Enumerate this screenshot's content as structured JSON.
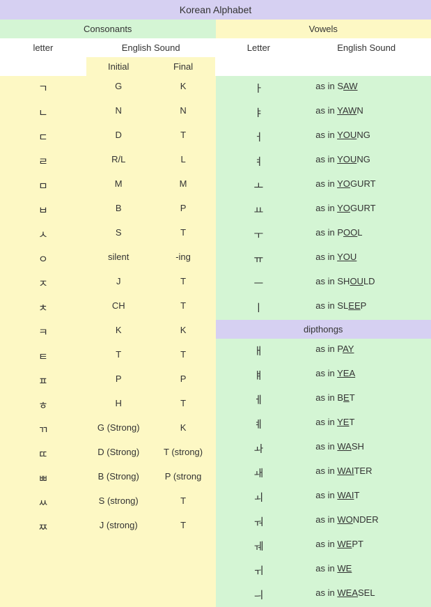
{
  "title": "Korean Alphabet",
  "headers": {
    "consonants": "Consonants",
    "vowels": "Vowels",
    "letter_left": "letter",
    "sound_left": "English Sound",
    "letter_right": "Letter",
    "sound_right": "English Sound",
    "initial": "Initial",
    "final": "Final",
    "dipthongs": "dipthongs"
  },
  "prefix": "as in ",
  "consonants": [
    {
      "letter": "ㄱ",
      "initial": "G",
      "final": "K"
    },
    {
      "letter": "ㄴ",
      "initial": "N",
      "final": "N"
    },
    {
      "letter": "ㄷ",
      "initial": "D",
      "final": "T"
    },
    {
      "letter": "ㄹ",
      "initial": "R/L",
      "final": "L"
    },
    {
      "letter": "ㅁ",
      "initial": "M",
      "final": "M"
    },
    {
      "letter": "ㅂ",
      "initial": "B",
      "final": "P"
    },
    {
      "letter": "ㅅ",
      "initial": "S",
      "final": "T"
    },
    {
      "letter": "ㅇ",
      "initial": "silent",
      "final": "-ing"
    },
    {
      "letter": "ㅈ",
      "initial": "J",
      "final": "T"
    },
    {
      "letter": "ㅊ",
      "initial": "CH",
      "final": "T"
    },
    {
      "letter": "ㅋ",
      "initial": "K",
      "final": "K"
    },
    {
      "letter": "ㅌ",
      "initial": "T",
      "final": "T"
    },
    {
      "letter": "ㅍ",
      "initial": "P",
      "final": "P"
    },
    {
      "letter": "ㅎ",
      "initial": "H",
      "final": "T"
    },
    {
      "letter": "ㄲ",
      "initial": "G (Strong)",
      "final": "K"
    },
    {
      "letter": "ㄸ",
      "initial": "D (Strong)",
      "final": "T (strong)"
    },
    {
      "letter": "ㅃ",
      "initial": "B (Strong)",
      "final": "P (strong"
    },
    {
      "letter": "ㅆ",
      "initial": "S (strong)",
      "final": "T"
    },
    {
      "letter": "ㅉ",
      "initial": "J (strong)",
      "final": "T"
    }
  ],
  "vowels": [
    {
      "letter": "ㅏ",
      "pre": "S",
      "u": "AW",
      "post": ""
    },
    {
      "letter": "ㅑ",
      "pre": "",
      "u": "YAW",
      "post": "N"
    },
    {
      "letter": "ㅓ",
      "pre": "",
      "u": "YOU",
      "post": "NG"
    },
    {
      "letter": "ㅕ",
      "pre": "",
      "u": "YOU",
      "post": "NG"
    },
    {
      "letter": "ㅗ",
      "pre": "",
      "u": "YO",
      "post": "GURT"
    },
    {
      "letter": "ㅛ",
      "pre": "",
      "u": "YO",
      "post": "GURT"
    },
    {
      "letter": "ㅜ",
      "pre": "P",
      "u": "OO",
      "post": "L"
    },
    {
      "letter": "ㅠ",
      "pre": "",
      "u": "YOU",
      "post": ""
    },
    {
      "letter": "ㅡ",
      "pre": "SH",
      "u": "OU",
      "post": "LD"
    },
    {
      "letter": "ㅣ",
      "pre": "SL",
      "u": "EE",
      "post": "P"
    }
  ],
  "dipthongs": [
    {
      "letter": "ㅐ",
      "pre": "P",
      "u": "AY",
      "post": ""
    },
    {
      "letter": "ㅒ",
      "pre": "",
      "u": "YEA",
      "post": ""
    },
    {
      "letter": "ㅔ",
      "pre": "B",
      "u": "E",
      "post": "T"
    },
    {
      "letter": "ㅖ",
      "pre": "",
      "u": "YE",
      "post": "T"
    },
    {
      "letter": "ㅘ",
      "pre": "",
      "u": "WA",
      "post": "SH"
    },
    {
      "letter": "ㅙ",
      "pre": "",
      "u": "WAI",
      "post": "TER"
    },
    {
      "letter": "ㅚ",
      "pre": "",
      "u": "WAI",
      "post": "T"
    },
    {
      "letter": "ㅝ",
      "pre": "",
      "u": "WO",
      "post": "NDER"
    },
    {
      "letter": "ㅞ",
      "pre": "",
      "u": "WE",
      "post": "PT"
    },
    {
      "letter": "ㅟ",
      "pre": "",
      "u": "WE",
      "post": ""
    },
    {
      "letter": "ㅢ",
      "pre": "",
      "u": "WEA",
      "post": "SEL"
    }
  ]
}
